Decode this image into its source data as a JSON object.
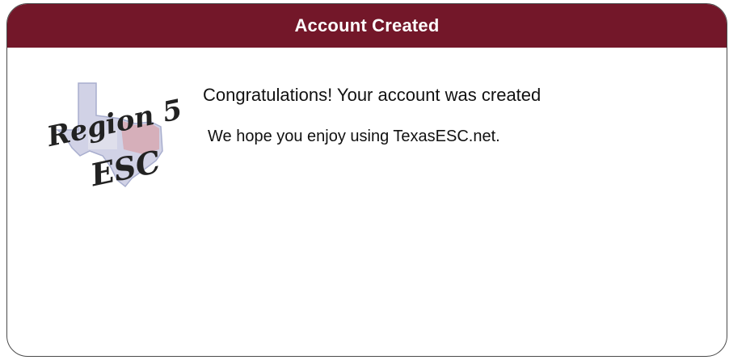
{
  "dialog": {
    "title": "Account Created",
    "message_title": "Congratulations! Your account was created",
    "message_body": "We hope you enjoy using TexasESC.net."
  },
  "logo": {
    "text_line1": "Region 5",
    "text_line2": "ESC",
    "icon": "texas-map-logo-icon"
  },
  "colors": {
    "titlebar": "#731729",
    "title_text": "#ffffff"
  }
}
